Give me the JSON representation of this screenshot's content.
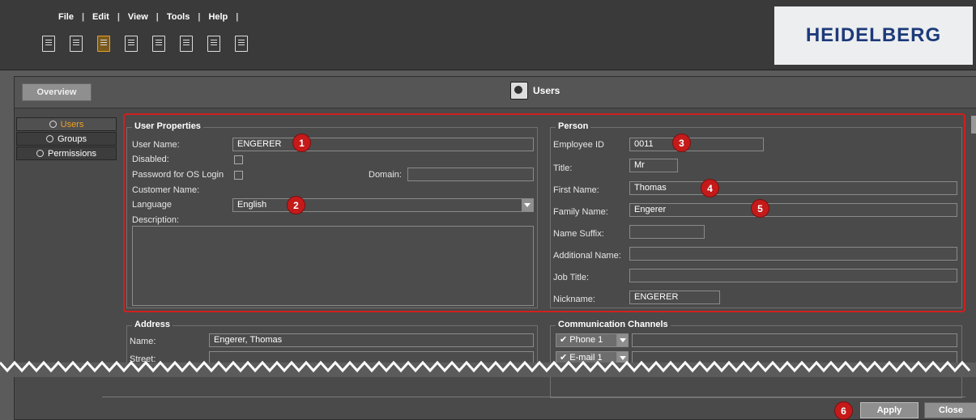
{
  "menu": {
    "items": [
      "File",
      "Edit",
      "View",
      "Tools",
      "Help"
    ]
  },
  "toolbar": {
    "icons": [
      "document-icon",
      "chart-icon",
      "user-settings-icon",
      "hierarchy-icon",
      "export-icon",
      "printer-icon",
      "signature-icon",
      "report-icon"
    ]
  },
  "logo": {
    "text": "HEIDELBERG"
  },
  "header": {
    "overview_label": "Overview",
    "title": "Users"
  },
  "sidebar": {
    "items": [
      {
        "label": "Users",
        "active": true
      },
      {
        "label": "Groups",
        "active": false
      },
      {
        "label": "Permissions",
        "active": false
      }
    ]
  },
  "user_properties": {
    "title": "User Properties",
    "user_name_label": "User Name:",
    "user_name_value": "ENGERER",
    "disabled_label": "Disabled:",
    "password_os_label": "Password for OS Login",
    "domain_label": "Domain:",
    "domain_value": "",
    "customer_name_label": "Customer Name:",
    "language_label": "Language",
    "language_value": "English",
    "description_label": "Description:",
    "description_value": ""
  },
  "person": {
    "title": "Person",
    "employee_id_label": "Employee ID",
    "employee_id_value": "0011",
    "title_label": "Title:",
    "title_value": "Mr",
    "first_name_label": "First Name:",
    "first_name_value": "Thomas",
    "family_name_label": "Family Name:",
    "family_name_value": "Engerer",
    "name_suffix_label": "Name Suffix:",
    "name_suffix_value": "",
    "additional_name_label": "Additional Name:",
    "additional_name_value": "",
    "job_title_label": "Job Title:",
    "job_title_value": "",
    "nickname_label": "Nickname:",
    "nickname_value": "ENGERER"
  },
  "address": {
    "title": "Address",
    "name_label": "Name:",
    "name_value": "Engerer, Thomas",
    "street_label": "Street:",
    "street_value": ""
  },
  "communication": {
    "title": "Communication Channels",
    "channels": [
      {
        "type": "Phone 1",
        "value": ""
      },
      {
        "type": "E-mail 1",
        "value": ""
      }
    ]
  },
  "callouts": [
    "1",
    "2",
    "3",
    "4",
    "5",
    "6"
  ],
  "buttons": {
    "apply": "Apply",
    "close": "Close"
  },
  "colors": {
    "accent_red": "#c51a1a",
    "active_nav": "#f0a020",
    "logo_blue": "#1d3a7a",
    "logo_yellow": "#e3b000"
  }
}
